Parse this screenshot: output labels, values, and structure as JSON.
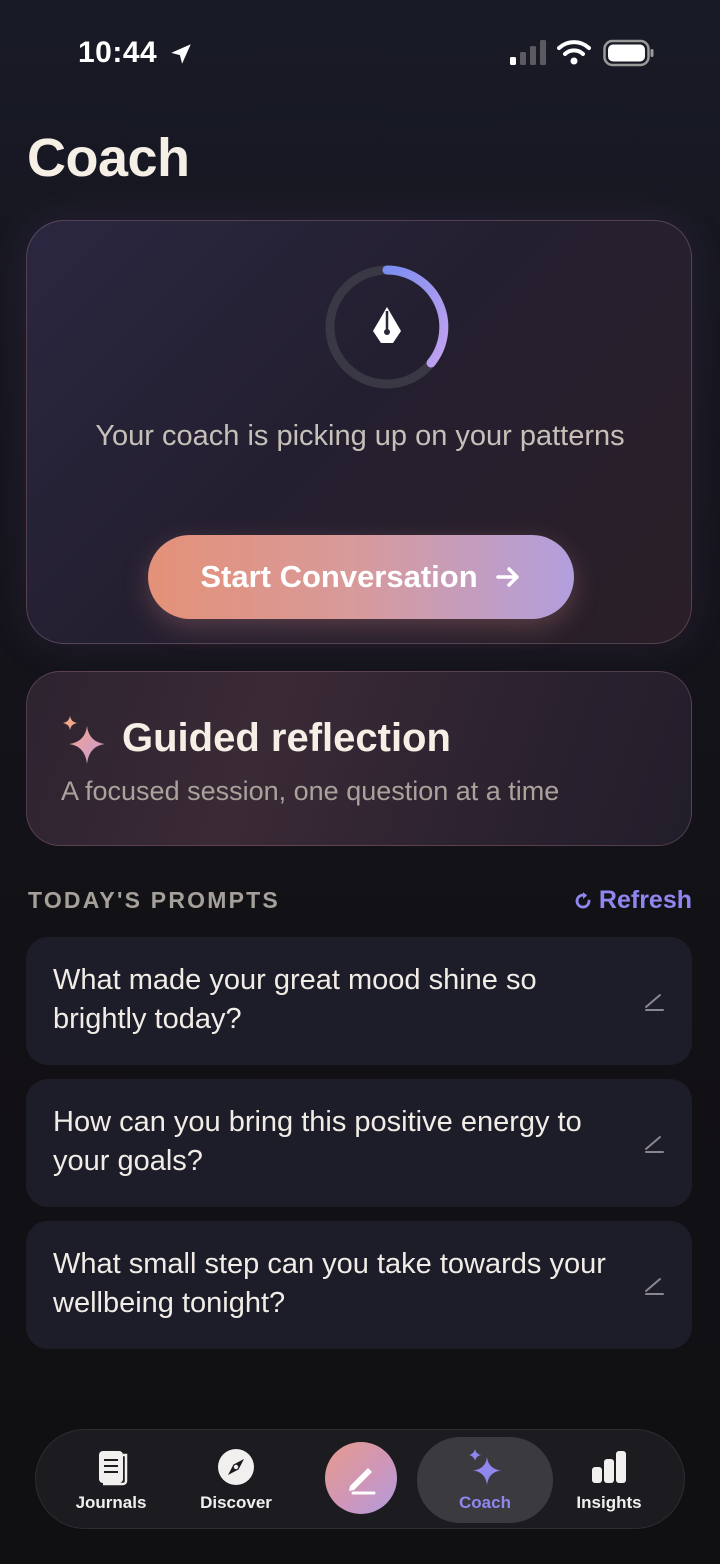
{
  "status_bar": {
    "time": "10:44"
  },
  "page": {
    "title": "Coach"
  },
  "coach_card": {
    "message": "Your coach is picking up on your patterns",
    "button_label": "Start Conversation"
  },
  "guided": {
    "title": "Guided reflection",
    "subtitle": "A focused session, one question at a time"
  },
  "prompts": {
    "section_label": "TODAY'S PROMPTS",
    "refresh_label": "Refresh",
    "items": [
      {
        "text": "What made your great mood shine so brightly today?"
      },
      {
        "text": "How can you bring this positive energy to your goals?"
      },
      {
        "text": "What small step can you take towards your wellbeing tonight?"
      }
    ]
  },
  "tab_bar": {
    "items": [
      {
        "label": "Journals",
        "icon": "journal-icon"
      },
      {
        "label": "Discover",
        "icon": "compass-icon"
      },
      {
        "label": "",
        "icon": "pen-icon"
      },
      {
        "label": "Coach",
        "icon": "sparkle-icon"
      },
      {
        "label": "Insights",
        "icon": "bar-chart-icon"
      }
    ],
    "active": "Coach"
  },
  "colors": {
    "accent": "#8f86ee",
    "button_gradient_start": "#e49178",
    "button_gradient_end": "#b29fde",
    "background": "#15151d"
  }
}
